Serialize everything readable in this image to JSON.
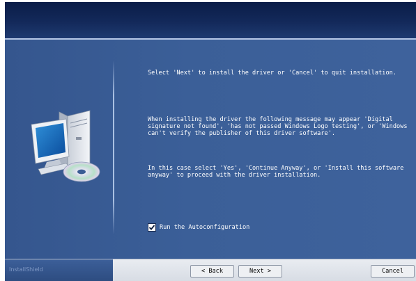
{
  "header": {
    "title": ""
  },
  "content": {
    "message1": "Select 'Next' to install the driver or 'Cancel' to quit installation.",
    "message2": "When installing the driver the following message may appear 'Digital\nsignature not found', 'has not passed Windows Logo testing', or 'Windows\ncan't verify the publisher of this driver software'.",
    "message3": "In this case select 'Yes', 'Continue Anyway', or 'Install this software\nanyway' to proceed with the driver installation.",
    "checkbox": {
      "label": "Run the Autoconfiguration",
      "checked": true
    }
  },
  "footer": {
    "brand": "InstallShield",
    "back_label": "< Back",
    "next_label": "Next >",
    "cancel_label": "Cancel"
  },
  "colors": {
    "panel": "#3a5c94",
    "header": "#0b1d48",
    "footer": "#d7dce4"
  },
  "icons": [
    "computer-icon",
    "monitor-icon",
    "cd-icon",
    "checkmark-icon"
  ]
}
